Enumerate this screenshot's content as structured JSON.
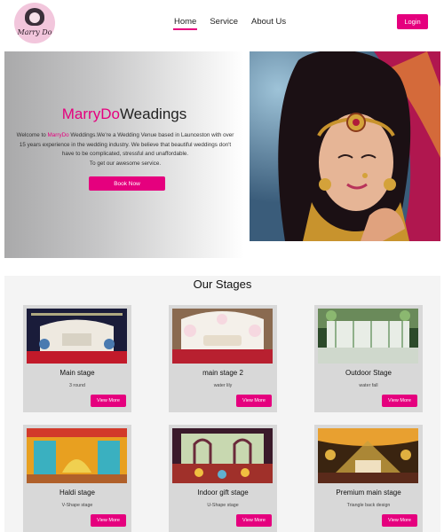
{
  "nav": {
    "logo_text": "Marry Do",
    "links": [
      "Home",
      "Service",
      "About Us"
    ],
    "active_link": "Home",
    "login_label": "Login"
  },
  "hero": {
    "title_brand": "MarryDo",
    "title_rest": "Weadings",
    "text_prefix": "Welcome to ",
    "text_brand": "MarryDo",
    "text_body": " Weddings.We're a Wedding Venue based in Launceston with over 15 years experience in the wedding industry. We believe that beautiful weddings don't have to be complicated, stressful and unaffordable.",
    "text_last": "To get our awesome service.",
    "book_label": "Book Now"
  },
  "stages": {
    "title": "Our Stages",
    "cards": [
      {
        "title": "Main stage",
        "subtitle": "3 round",
        "button": "View More"
      },
      {
        "title": "main stage 2",
        "subtitle": "water lily",
        "button": "View More"
      },
      {
        "title": "Outdoor Stage",
        "subtitle": "water fall",
        "button": "View More"
      },
      {
        "title": "Haldi stage",
        "subtitle": "V-Shape stage",
        "button": "View More"
      },
      {
        "title": "Indoor gift stage",
        "subtitle": "U-Shape stage",
        "button": "View More"
      },
      {
        "title": "Premium main stage",
        "subtitle": "Triangle back design",
        "button": "View More"
      }
    ]
  },
  "colors": {
    "accent": "#e5007e"
  }
}
